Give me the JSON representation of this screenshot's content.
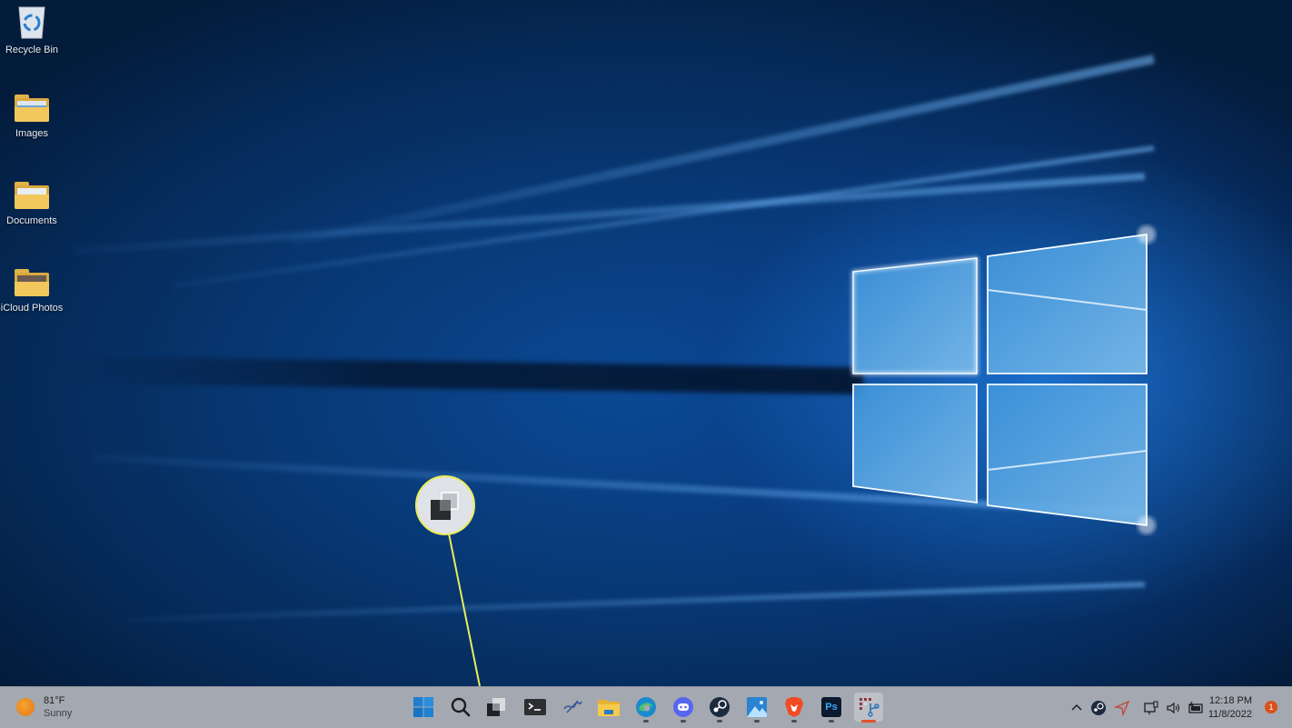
{
  "desktop": {
    "icons": [
      {
        "label": "Recycle Bin",
        "icon": "recycle-bin-icon"
      },
      {
        "label": "Images",
        "icon": "folder-icon"
      },
      {
        "label": "Documents",
        "icon": "folder-icon"
      },
      {
        "label": "iCloud Photos",
        "icon": "folder-icon"
      }
    ]
  },
  "callout": {
    "icon": "task-view-icon",
    "highlight_color": "#e9ec5a"
  },
  "taskbar": {
    "weather": {
      "temperature": "81°F",
      "condition": "Sunny",
      "icon": "sun-icon"
    },
    "apps": [
      {
        "name": "Start",
        "icon": "windows-start-icon",
        "running": false
      },
      {
        "name": "Search",
        "icon": "search-icon",
        "running": false
      },
      {
        "name": "Task View",
        "icon": "task-view-icon",
        "running": false
      },
      {
        "name": "Terminal",
        "icon": "terminal-icon",
        "running": false
      },
      {
        "name": "App",
        "icon": "signature-app-icon",
        "running": false
      },
      {
        "name": "File Explorer",
        "icon": "file-explorer-icon",
        "running": false
      },
      {
        "name": "Microsoft Edge",
        "icon": "edge-icon",
        "running": true
      },
      {
        "name": "Discord",
        "icon": "discord-icon",
        "running": true
      },
      {
        "name": "Steam",
        "icon": "steam-icon",
        "running": true
      },
      {
        "name": "Photos",
        "icon": "photos-icon",
        "running": true
      },
      {
        "name": "Brave",
        "icon": "brave-icon",
        "running": true
      },
      {
        "name": "Photoshop",
        "icon": "photoshop-icon",
        "label": "Ps",
        "running": true
      },
      {
        "name": "Snipping Tool",
        "icon": "snipping-tool-icon",
        "running": true,
        "active": true
      }
    ],
    "tray": {
      "icons": [
        "chevron-up-icon",
        "steam-tray-icon",
        "location-icon",
        "network-icon",
        "volume-icon",
        "battery-icon"
      ],
      "time": "12:18 PM",
      "date": "11/8/2022",
      "notification_count": "1"
    },
    "accent_color": "#e0522d"
  }
}
